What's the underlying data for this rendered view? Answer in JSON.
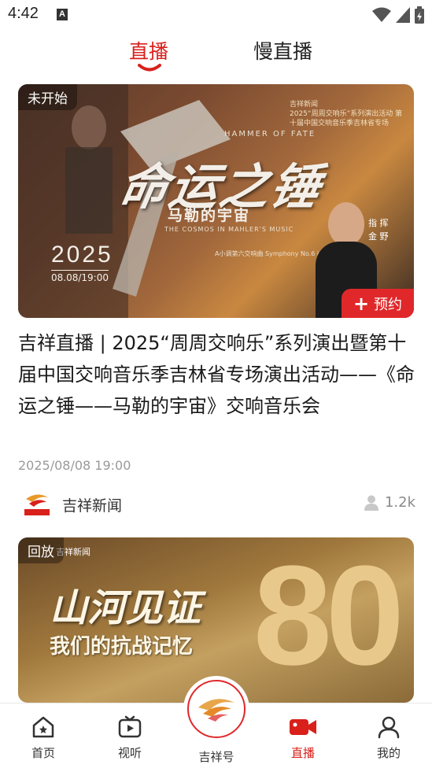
{
  "status_bar": {
    "time": "4:42",
    "notification_glyph": "A"
  },
  "top_tabs": [
    {
      "label": "直播",
      "active": true
    },
    {
      "label": "慢直播",
      "active": false
    }
  ],
  "feed": {
    "cards": [
      {
        "badge": "未开始",
        "reserve_label": "预约",
        "poster": {
          "title": "命运之锤",
          "subtitle": "马勒的宇宙",
          "subtitle_en": "THE COSMOS IN MAHLER'S MUSIC",
          "hammer_en": "HAMMER OF FATE",
          "year": "2025",
          "datetime": "08.08/19:00",
          "symphony": "A小调第六交响曲 Symphony No.6 in A Minor",
          "conductor_role": "指 挥",
          "conductor_name": "金 野",
          "brand": "吉祥新闻",
          "series_line": "2025“周周交响乐”系列演出活动 第十届中国交响音乐季吉林省专场"
        },
        "title": "吉祥直播 | 2025“周周交响乐”系列演出暨第十届中国交响音乐季吉林省专场演出活动——《命运之锤——马勒的宇宙》交响音乐会",
        "date": "2025/08/08 19:00",
        "source": "吉祥新闻",
        "viewers": "1.2k"
      },
      {
        "badge": "回放",
        "poster": {
          "brand": "吉祥新闻",
          "title": "山河见证",
          "subtitle": "我们的抗战记忆",
          "number": "80"
        }
      }
    ]
  },
  "bottom_nav": [
    {
      "label": "首页",
      "icon": "home-icon",
      "active": false
    },
    {
      "label": "视听",
      "icon": "tv-icon",
      "active": false
    },
    {
      "label": "吉祥号",
      "icon": "jixiang-logo-icon",
      "active": false
    },
    {
      "label": "直播",
      "icon": "video-camera-icon",
      "active": true
    },
    {
      "label": "我的",
      "icon": "user-icon",
      "active": false
    }
  ],
  "colors": {
    "accent": "#d9201b",
    "reserve": "#e0282a",
    "muted": "#9a9a9a"
  }
}
